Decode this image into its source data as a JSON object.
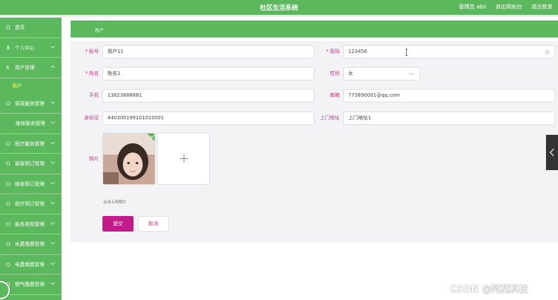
{
  "header": {
    "title": "社区生活系统",
    "user_label": "管理员 abo",
    "backend_link": "退出到前台",
    "logout_link": "退出登录"
  },
  "sidebar": {
    "items": [
      {
        "label": "首页",
        "icon": "home-icon"
      },
      {
        "label": "个人中心",
        "icon": "user-icon"
      },
      {
        "label": "用户管理",
        "icon": "users-icon"
      },
      {
        "label": "用户",
        "icon": ""
      },
      {
        "label": "家政服务管理",
        "icon": "list-icon"
      },
      {
        "label": "维修服务管理",
        "icon": ""
      },
      {
        "label": "医疗服务管理",
        "icon": "list-icon"
      },
      {
        "label": "家政预订管理",
        "icon": "list-icon"
      },
      {
        "label": "维修预订管理",
        "icon": "list-icon"
      },
      {
        "label": "医疗预订管理",
        "icon": "list-icon"
      },
      {
        "label": "服务类型管理",
        "icon": "list-icon"
      },
      {
        "label": "水费缴费管理",
        "icon": "list-icon"
      },
      {
        "label": "电费缴费管理",
        "icon": "list-icon"
      },
      {
        "label": "燃气缴费管理",
        "icon": "list-icon"
      }
    ]
  },
  "breadcrumb": {
    "current": "用户"
  },
  "form": {
    "account": {
      "label": "账号",
      "value": "用户11"
    },
    "password": {
      "label": "密码",
      "value": "123456"
    },
    "name": {
      "label": "姓名",
      "value": "姓名1"
    },
    "gender": {
      "label": "性别",
      "value": "女"
    },
    "phone": {
      "label": "手机",
      "value": "13823888881"
    },
    "email": {
      "label": "邮箱",
      "value": "773890001@qq.com"
    },
    "idcard": {
      "label": "身份证",
      "value": "440300199101010001"
    },
    "address": {
      "label": "上门地址",
      "value": "上门地址1"
    },
    "photo": {
      "label": "照片",
      "tip": "点击上传照片"
    },
    "submit_label": "提交",
    "cancel_label": "取消"
  },
  "watermark": "CSDN @阿莫科技",
  "colors": {
    "primary": "#5cb85c",
    "accent": "#c41b8a"
  }
}
